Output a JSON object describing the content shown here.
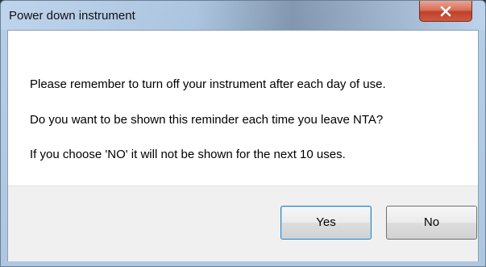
{
  "dialog": {
    "title": "Power down instrument",
    "close_icon": "close-icon",
    "messages": [
      "Please remember to turn off your instrument after each day of use.",
      "Do you want to be shown this reminder each time you leave NTA?",
      "If you choose 'NO' it will not be shown for the next 10 uses."
    ],
    "buttons": {
      "yes_label": "Yes",
      "no_label": "No"
    }
  },
  "colors": {
    "close_button": "#c0412a",
    "default_button_border": "#3c7fb1"
  }
}
